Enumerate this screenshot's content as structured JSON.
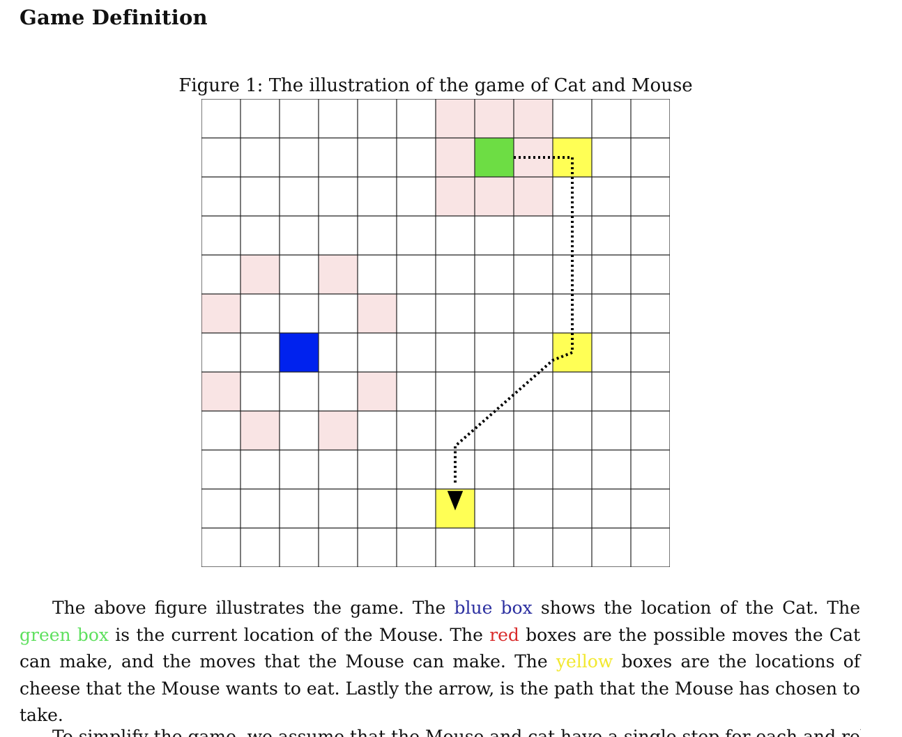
{
  "heading": "Game Definition",
  "figure": {
    "caption": "Figure 1: The illustration of the game of Cat and Mouse",
    "grid": {
      "rows": 12,
      "cols": 12,
      "cat": [
        6,
        2
      ],
      "mouse": [
        1,
        7
      ],
      "cheese": [
        [
          1,
          9
        ],
        [
          6,
          9
        ],
        [
          10,
          6
        ]
      ],
      "possible_moves": [
        [
          0,
          6
        ],
        [
          0,
          7
        ],
        [
          0,
          8
        ],
        [
          1,
          6
        ],
        [
          1,
          8
        ],
        [
          2,
          6
        ],
        [
          2,
          7
        ],
        [
          2,
          8
        ],
        [
          4,
          1
        ],
        [
          4,
          3
        ],
        [
          5,
          0
        ],
        [
          5,
          4
        ],
        [
          7,
          0
        ],
        [
          7,
          4
        ],
        [
          8,
          1
        ],
        [
          8,
          3
        ]
      ],
      "path": [
        [
          1,
          7
        ],
        [
          1,
          9
        ],
        [
          6,
          9
        ],
        [
          10,
          6
        ]
      ]
    },
    "colors": {
      "cat": "#0022ee",
      "mouse": "#6ddd44",
      "cheese": "#ffff55",
      "possible_move": "#f9e4e4",
      "grid_line": "#222222"
    }
  },
  "paragraph": {
    "t1": "The above figure illustrates the game.  The ",
    "blue": "blue box",
    "t2": " shows the location of the Cat.  The ",
    "green": "green box",
    "t3": " is the current location of the Mouse.  The ",
    "red": "red",
    "t4": " boxes are the possible moves the Cat can make, and the moves that the Mouse can make.  The ",
    "yellow": "yellow",
    "t5": " boxes are the locations of cheese that the Mouse wants to eat.  Lastly the arrow, is the path that the Mouse has chosen to take."
  },
  "next_line": "To simplify the game, we assume that the Mouse and cat have a single step for each and relative the"
}
